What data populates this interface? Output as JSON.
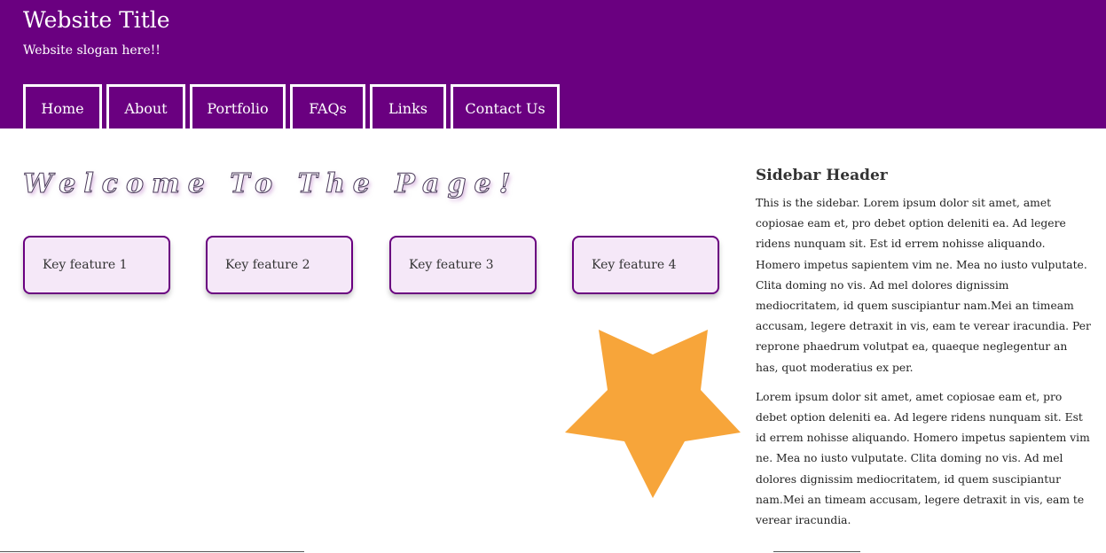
{
  "header": {
    "title": "Website Title",
    "slogan": "Website slogan here!!",
    "background": "#6a0080"
  },
  "nav": {
    "items": [
      {
        "label": "Home"
      },
      {
        "label": "About"
      },
      {
        "label": "Portfolio"
      },
      {
        "label": "FAQs"
      },
      {
        "label": "Links"
      },
      {
        "label": "Contact Us"
      }
    ]
  },
  "main": {
    "title": "Welcome To The Page!",
    "features": [
      {
        "label": "Key feature 1"
      },
      {
        "label": "Key feature 2"
      },
      {
        "label": "Key feature 3"
      },
      {
        "label": "Key feature 4"
      }
    ],
    "star_color": "#f7a53a"
  },
  "sidebar": {
    "header": "Sidebar Header",
    "paragraphs": [
      "This is the sidebar. Lorem ipsum dolor sit amet, amet copiosae eam et, pro debet option deleniti ea. Ad legere ridens nunquam sit. Est id errem nohisse aliquando. Homero impetus sapientem vim ne. Mea no iusto vulputate. Clita doming no vis. Ad mel dolores dignissim mediocritatem, id quem suscipiantur nam.Mei an timeam accusam, legere detraxit in vis, eam te verear iracundia. Per reprone phaedrum volutpat ea, quaeque neglegentur an has, quot moderatius ex per.",
      "Lorem ipsum dolor sit amet, amet copiosae eam et, pro debet option deleniti ea. Ad legere ridens nunquam sit. Est id errem nohisse aliquando. Homero impetus sapientem vim ne. Mea no iusto vulputate. Clita doming no vis. Ad mel dolores dignissim mediocritatem, id quem suscipiantur nam.Mei an timeam accusam, legere detraxit in vis, eam te verear iracundia."
    ]
  },
  "colors": {
    "accent": "#6a0080",
    "feature_bg": "#f5e8f8"
  }
}
